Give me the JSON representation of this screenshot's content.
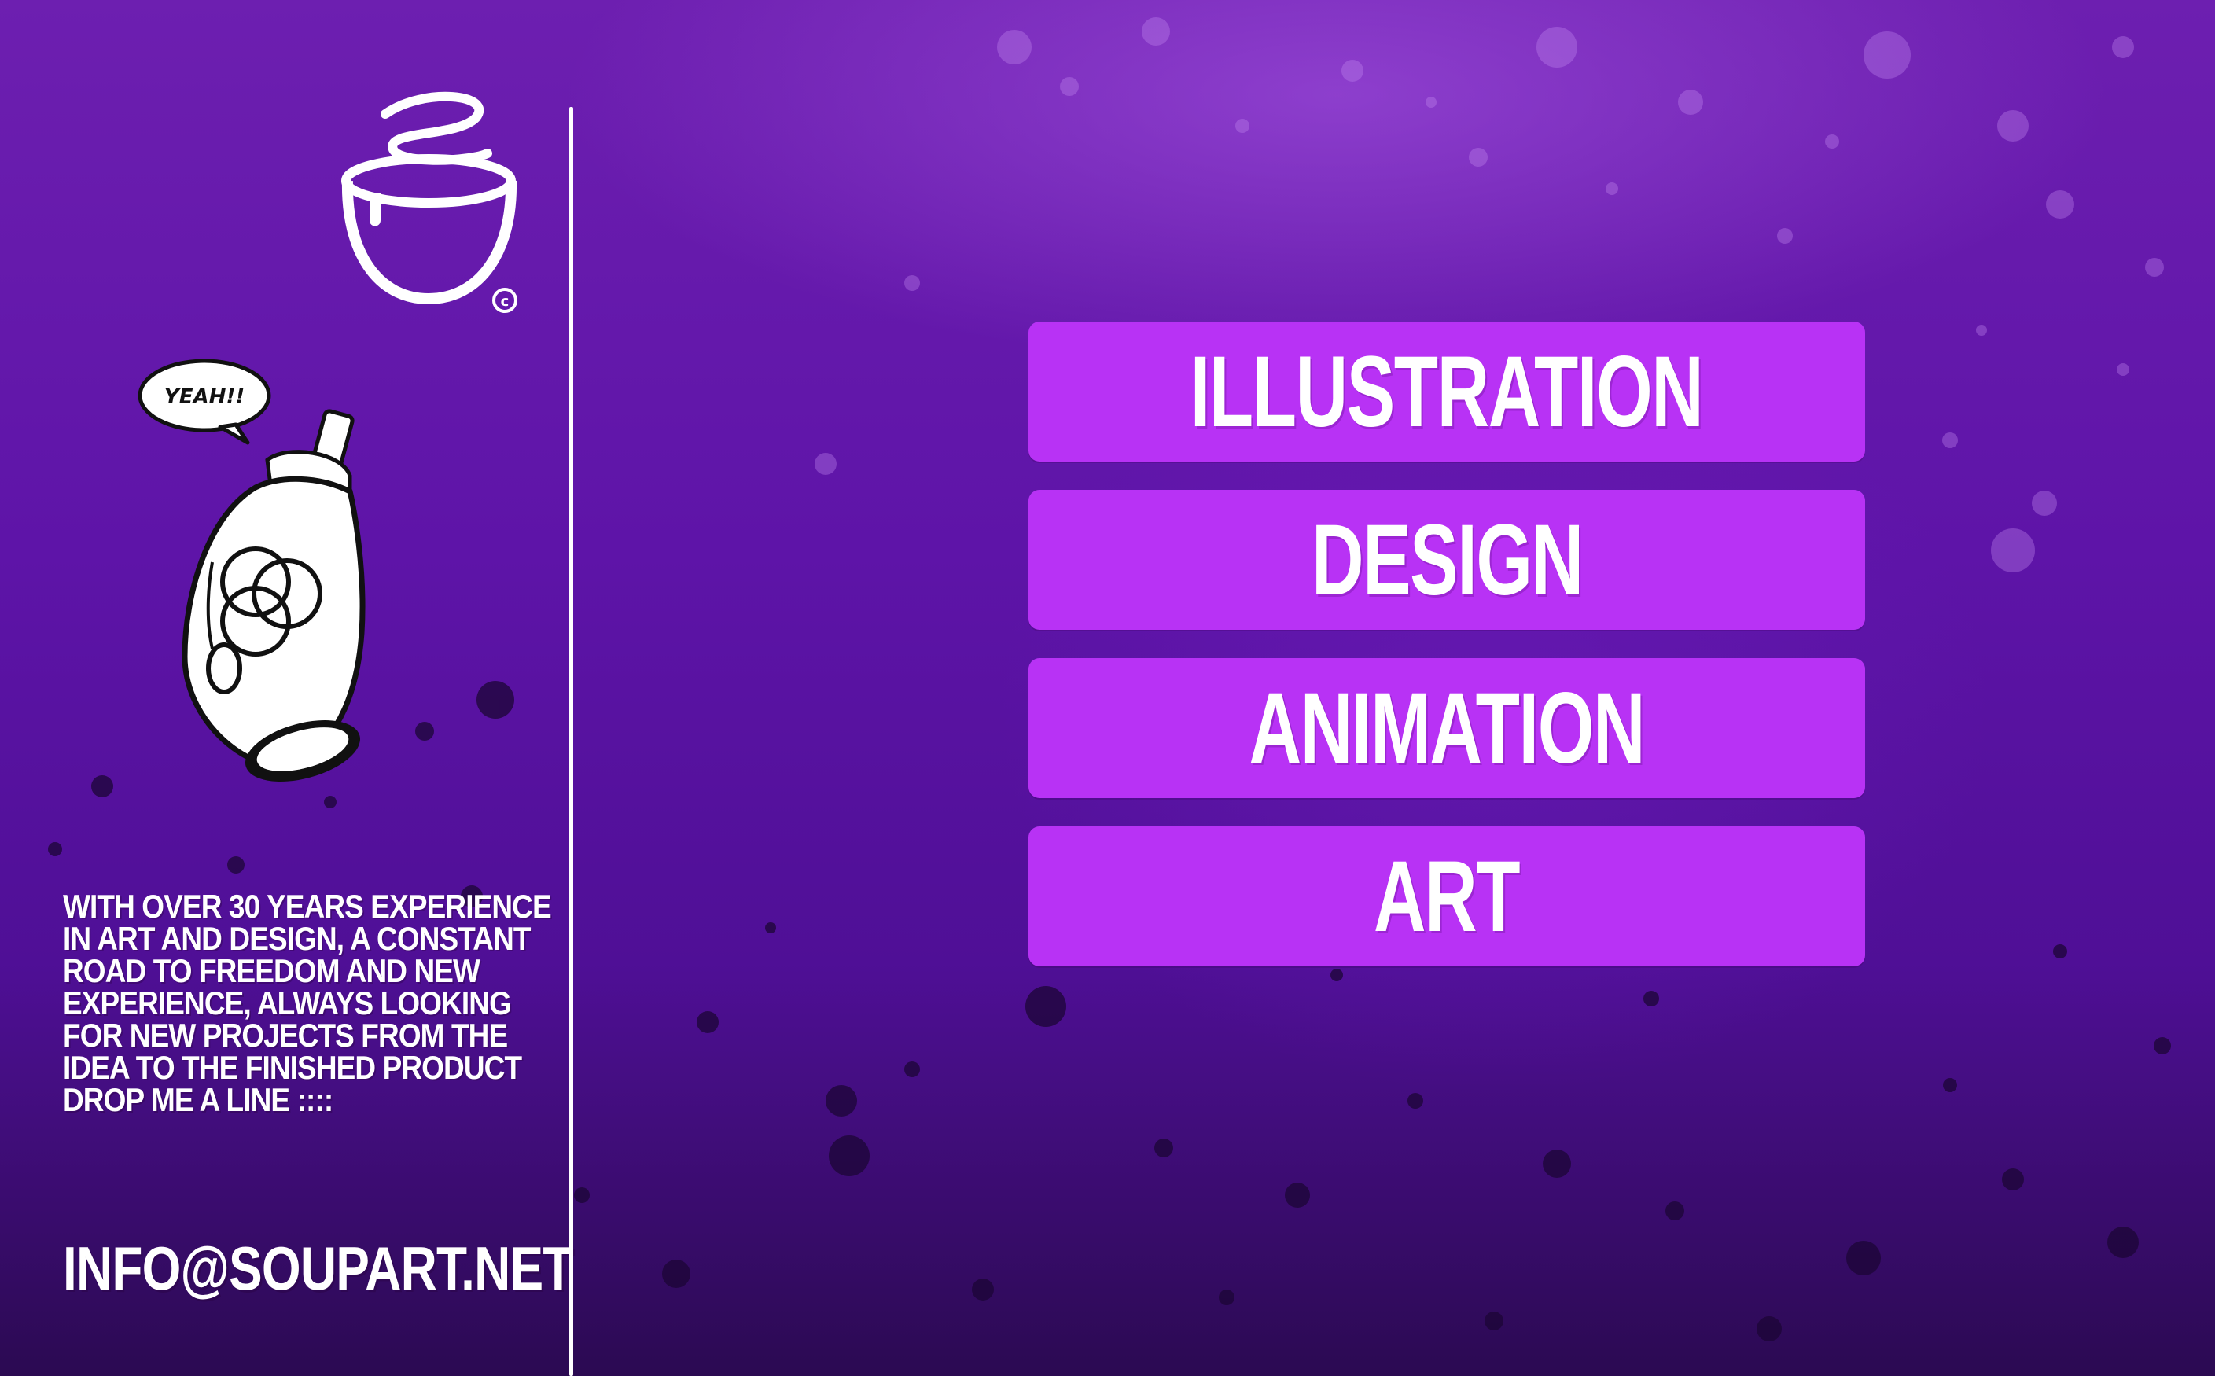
{
  "menu": {
    "items": [
      {
        "label": "Illustration"
      },
      {
        "label": "Design"
      },
      {
        "label": "Animation"
      },
      {
        "label": "Art"
      }
    ]
  },
  "sidebar": {
    "mascot_speech": "YEAH!!",
    "about_lines": [
      "With over 30 years experience",
      "in  art and design, a constant",
      "road to freedom and new",
      "experience, always looking",
      "for new projects  from the",
      "idea to the finished product",
      "drop me a line ::::"
    ],
    "email": "info@soupart.net"
  },
  "colors": {
    "background_top": "#6d1fb0",
    "background_bottom": "#2b0a52",
    "menu_button": "#b832f5",
    "text": "#ffffff"
  },
  "icons": {
    "logo": "soup-bowl-logo",
    "mascot": "spray-can-mascot"
  }
}
